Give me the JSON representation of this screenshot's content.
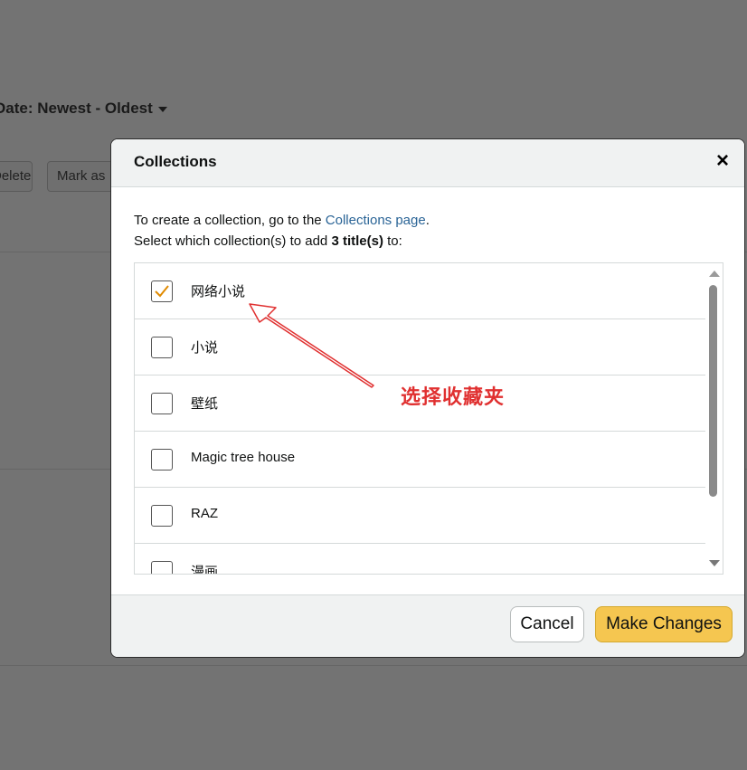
{
  "background": {
    "sort_label": "Date: Newest - Oldest",
    "delete_label": "Delete",
    "mark_label": "Mark as"
  },
  "modal": {
    "title": "Collections",
    "close_glyph": "×",
    "intro_line1_prefix": "To create a collection, go to the ",
    "intro_link": "Collections page",
    "intro_line1_suffix": ".",
    "intro_line2_prefix": "Select which collection(s) to add ",
    "intro_count": "3 title(s)",
    "intro_line2_suffix": " to:",
    "items": [
      {
        "label": "网络小说",
        "checked": true
      },
      {
        "label": "小说",
        "checked": false
      },
      {
        "label": "壁纸",
        "checked": false
      },
      {
        "label": "Magic tree house",
        "checked": false
      },
      {
        "label": "RAZ",
        "checked": false
      },
      {
        "label": "漫画",
        "checked": false
      }
    ],
    "cancel_label": "Cancel",
    "make_changes_label": "Make Changes"
  },
  "annotation": {
    "text": "选择收藏夹",
    "color": "#e03030"
  },
  "colors": {
    "check": "#e08a00",
    "primary_button": "#f5c650",
    "link": "#2a6496"
  }
}
